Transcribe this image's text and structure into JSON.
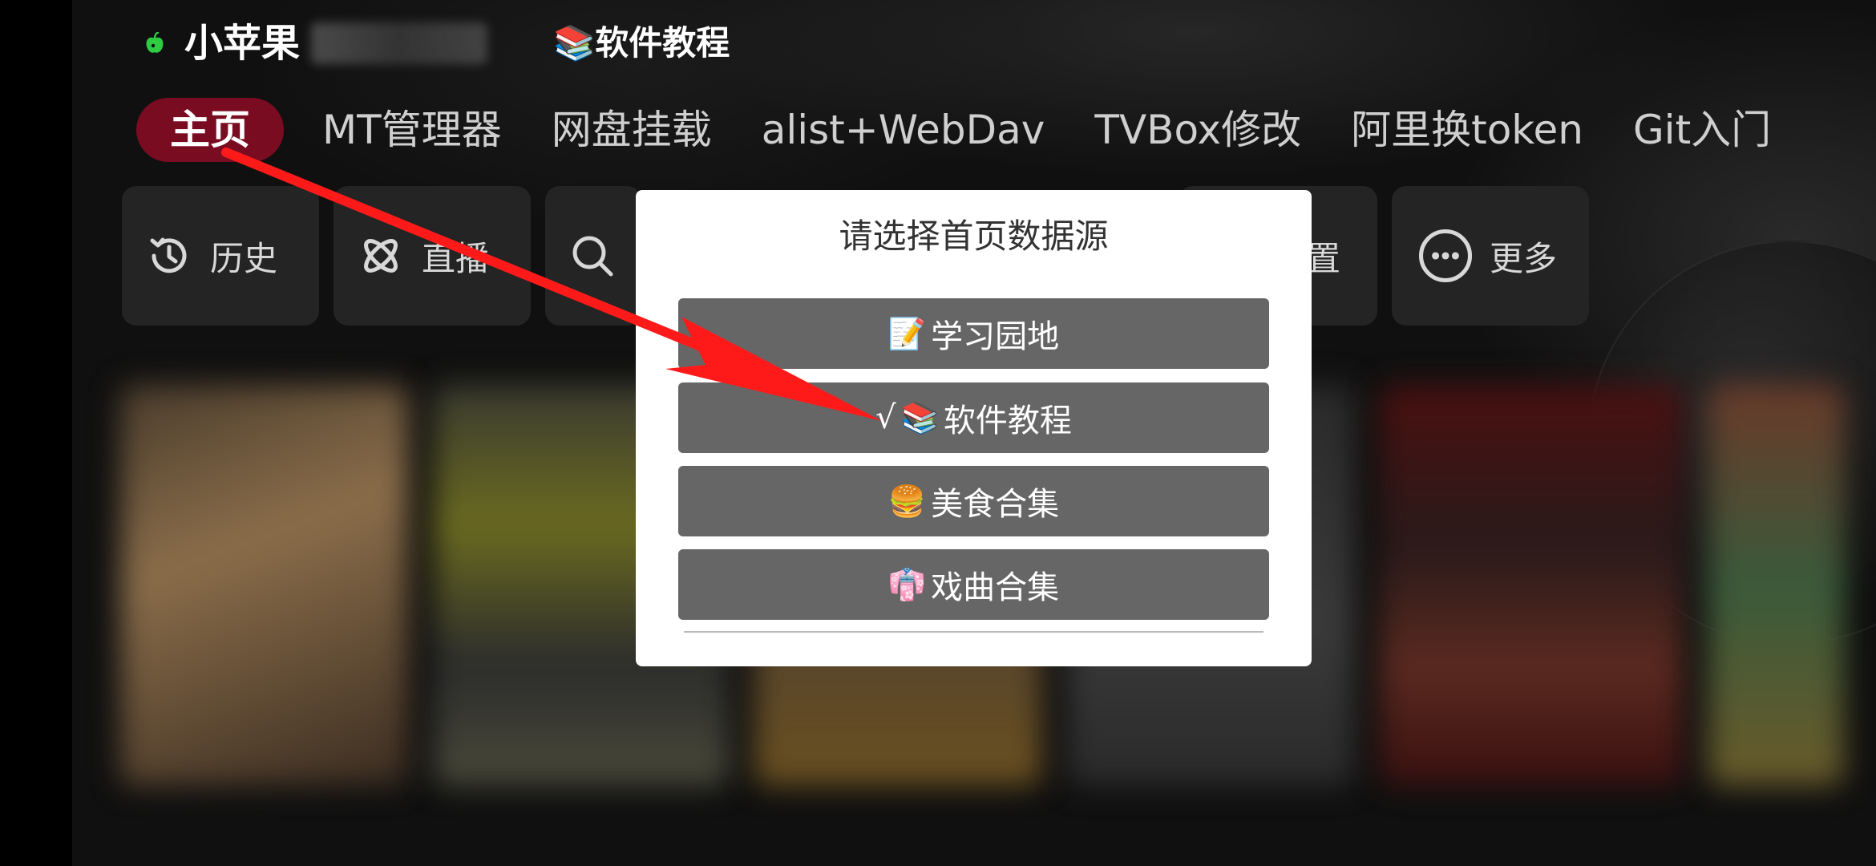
{
  "header": {
    "app_title": "小苹果",
    "current_source": "📚软件教程"
  },
  "tabs": [
    {
      "label": "主页",
      "active": true
    },
    {
      "label": "MT管理器"
    },
    {
      "label": "网盘挂载"
    },
    {
      "label": "alist+WebDav"
    },
    {
      "label": "TVBox修改"
    },
    {
      "label": "阿里换token"
    },
    {
      "label": "Git入门"
    }
  ],
  "quick_actions": {
    "history": "历史",
    "live": "直播",
    "settings_partial": "置",
    "more": "更多"
  },
  "dialog": {
    "title": "请选择首页数据源",
    "options": [
      {
        "emoji": "📝",
        "label": "学习园地"
      },
      {
        "emoji": "📚",
        "label": "软件教程",
        "check": "√"
      },
      {
        "emoji": "🍔",
        "label": "美食合集"
      },
      {
        "emoji": "👘",
        "label": "戏曲合集"
      }
    ]
  },
  "colors": {
    "active_tab": "#7a0c22",
    "option_bg": "#666666",
    "arrow": "#ff1a1a",
    "logo_green": "#2ecc40"
  }
}
